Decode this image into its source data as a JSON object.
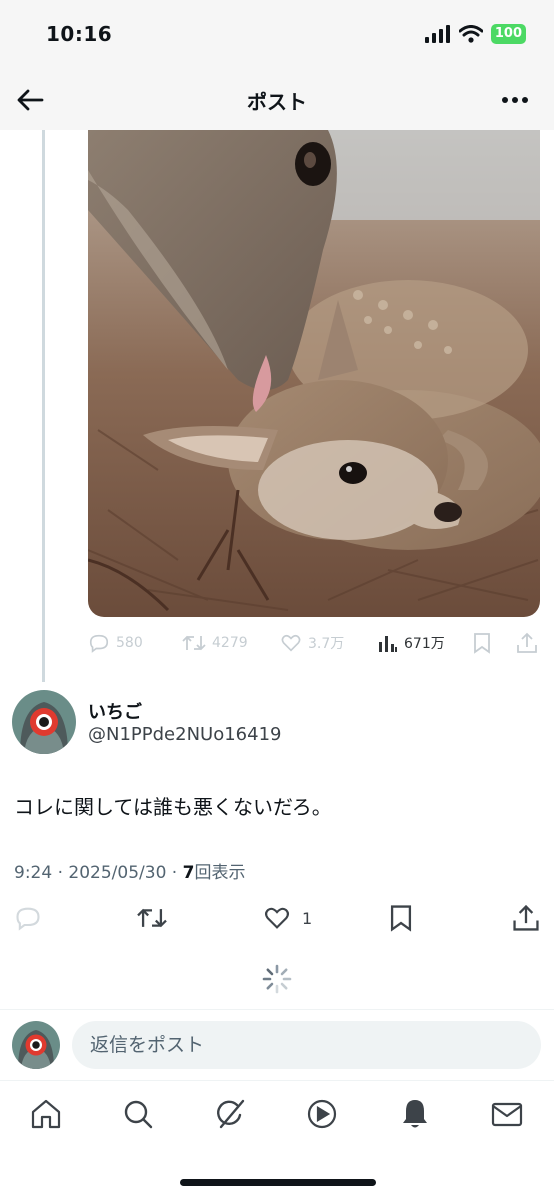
{
  "status_bar": {
    "time": "10:16",
    "battery": "100"
  },
  "header": {
    "title": "ポスト"
  },
  "quoted_post": {
    "stats": {
      "replies": "580",
      "reposts": "4279",
      "likes": "3.7万",
      "views": "671万"
    }
  },
  "reply": {
    "author_name": "いちご",
    "author_handle": "@N1PPde2NUo16419",
    "text": "コレに関しては誰も悪くないだろ。",
    "time": "9:24",
    "date": "2025/05/30",
    "view_count": "7",
    "view_label": "回表示",
    "like_count": "1"
  },
  "composer": {
    "placeholder": "返信をポスト"
  },
  "tabs": [
    "home-icon",
    "search-icon",
    "grok-icon",
    "video-icon",
    "notifications-icon",
    "messages-icon"
  ],
  "colors": {
    "accent": "#1d9bf0",
    "text": "#0f1419",
    "muted": "#536471",
    "battery": "#4cd964"
  }
}
